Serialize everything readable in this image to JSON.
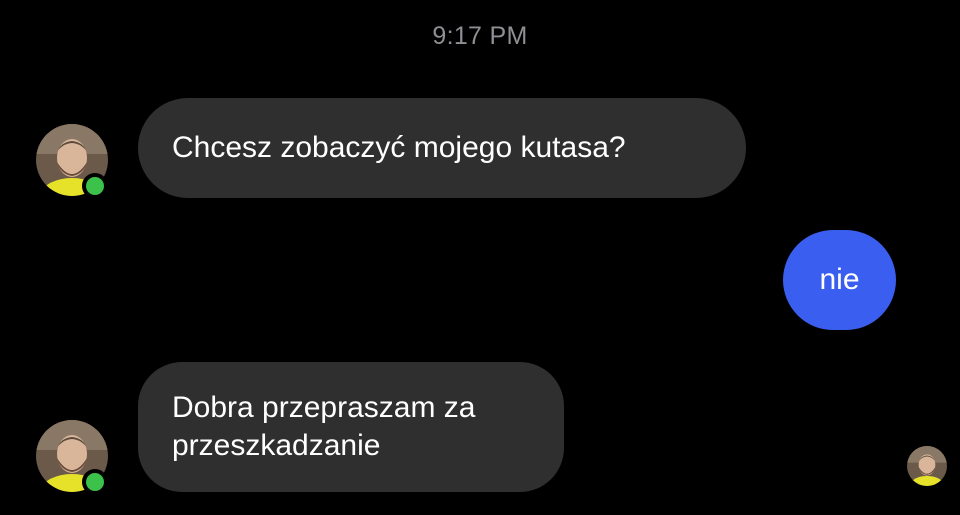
{
  "conversation": {
    "timestamp": "9:17 PM",
    "messages": [
      {
        "sender": "contact",
        "lines": [
          "Chcesz zobaczyć mojego kutasa?"
        ]
      },
      {
        "sender": "me",
        "lines": [
          "nie"
        ]
      },
      {
        "sender": "contact",
        "lines": [
          "Dobra przepraszam za",
          "przeszkadzanie"
        ]
      }
    ]
  },
  "colors": {
    "background": "#000000",
    "incoming_bubble": "#2f2f2f",
    "outgoing_bubble": "#3a5ff0",
    "timestamp_text": "#8e8e93",
    "online_indicator": "#3cc14a"
  },
  "icons": {
    "contact_avatar": "contact-avatar-photo",
    "online_status": "online-indicator",
    "read_receipt": "seen-avatar-icon"
  }
}
